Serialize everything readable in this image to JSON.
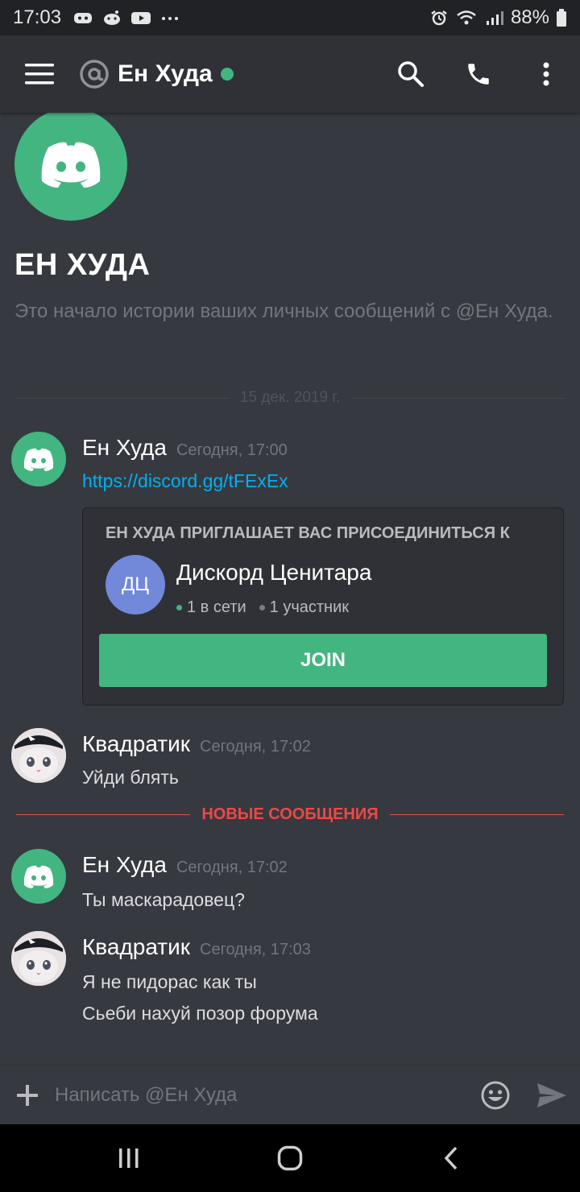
{
  "status_bar": {
    "time": "17:03",
    "left_icons": [
      "discord-notification-icon",
      "reddit-icon",
      "youtube-icon",
      "more-dots-icon"
    ],
    "right_icons": [
      "alarm-icon",
      "wifi-icon",
      "signal-icon"
    ],
    "battery": "88%"
  },
  "header": {
    "title": "Ен Худа",
    "status": "online",
    "actions": [
      "search-icon",
      "phone-icon",
      "more-vertical-icon"
    ]
  },
  "intro": {
    "name": "ЕН ХУДА",
    "description": "Это начало истории ваших личных сообщений с @Ен Худа."
  },
  "date_divider": "15 дек. 2019 г.",
  "messages": [
    {
      "author": "Ен Худа",
      "time": "Сегодня, 17:00",
      "lines": [
        "https://discord.gg/tFExEx"
      ]
    },
    {
      "author": "Квадратик",
      "time": "Сегодня, 17:02",
      "lines": [
        "Уйди блять"
      ]
    },
    {
      "author": "Ен Худа",
      "time": "Сегодня, 17:02",
      "lines": [
        "Ты маскарадовец?"
      ]
    },
    {
      "author": "Квадратик",
      "time": "Сегодня, 17:03",
      "lines": [
        "Я не пидорас как ты",
        "Сьеби нахуй позор форума"
      ]
    }
  ],
  "invite": {
    "title": "ЕН ХУДА ПРИГЛАШАЕТ ВАС ПРИСОЕДИНИТЬСЯ К",
    "server_initials": "ДЦ",
    "server_name": "Дискорд Ценитара",
    "online": "1 в сети",
    "members": "1 участник",
    "join_label": "JOIN"
  },
  "new_messages_label": "НОВЫЕ СООБЩЕНИЯ",
  "composer": {
    "placeholder": "Написать @Ен Худа"
  },
  "colors": {
    "background": "#36393f",
    "header": "#2f3136",
    "online": "#43b581",
    "link": "#00b0f4",
    "new_divider": "#f04747",
    "server_icon": "#7289da"
  }
}
